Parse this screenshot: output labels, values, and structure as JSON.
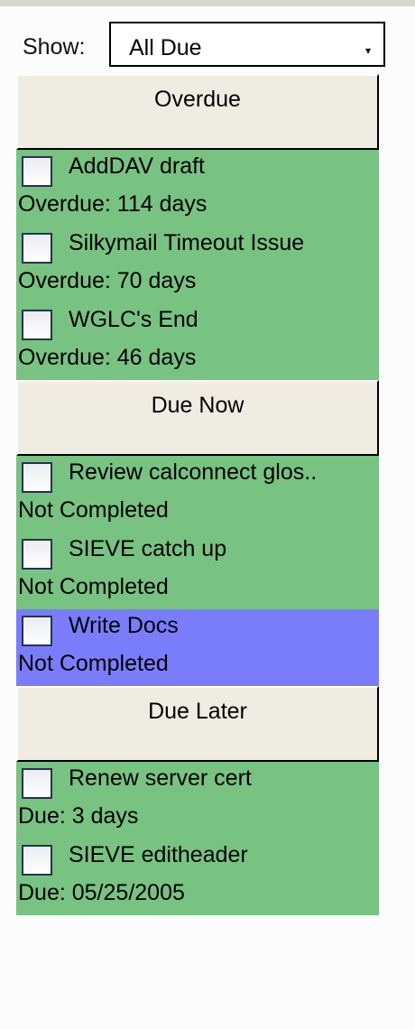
{
  "toolbar": {
    "show_label": "Show:",
    "filter_value": "All Due",
    "caret": "▾"
  },
  "groups": [
    {
      "header": "Overdue",
      "tasks": [
        {
          "title": "AddDAV draft",
          "status": "Overdue: 114 days",
          "color": "#78c282"
        },
        {
          "title": "Silkymail Timeout Issue",
          "status": "Overdue: 70 days",
          "color": "#78c282"
        },
        {
          "title": "WGLC's End",
          "status": "Overdue: 46 days",
          "color": "#78c282"
        }
      ]
    },
    {
      "header": "Due Now",
      "tasks": [
        {
          "title": "Review calconnect glos..",
          "status": "Not Completed",
          "color": "#78c282"
        },
        {
          "title": "SIEVE catch up",
          "status": "Not Completed",
          "color": "#78c282"
        },
        {
          "title": "Write Docs",
          "status": "Not Completed",
          "color": "#7a7dfb"
        }
      ]
    },
    {
      "header": "Due Later",
      "tasks": [
        {
          "title": "Renew server cert",
          "status": "Due: 3 days",
          "color": "#78c282"
        },
        {
          "title": "SIEVE editheader",
          "status": "Due: 05/25/2005",
          "color": "#78c282"
        }
      ]
    }
  ]
}
